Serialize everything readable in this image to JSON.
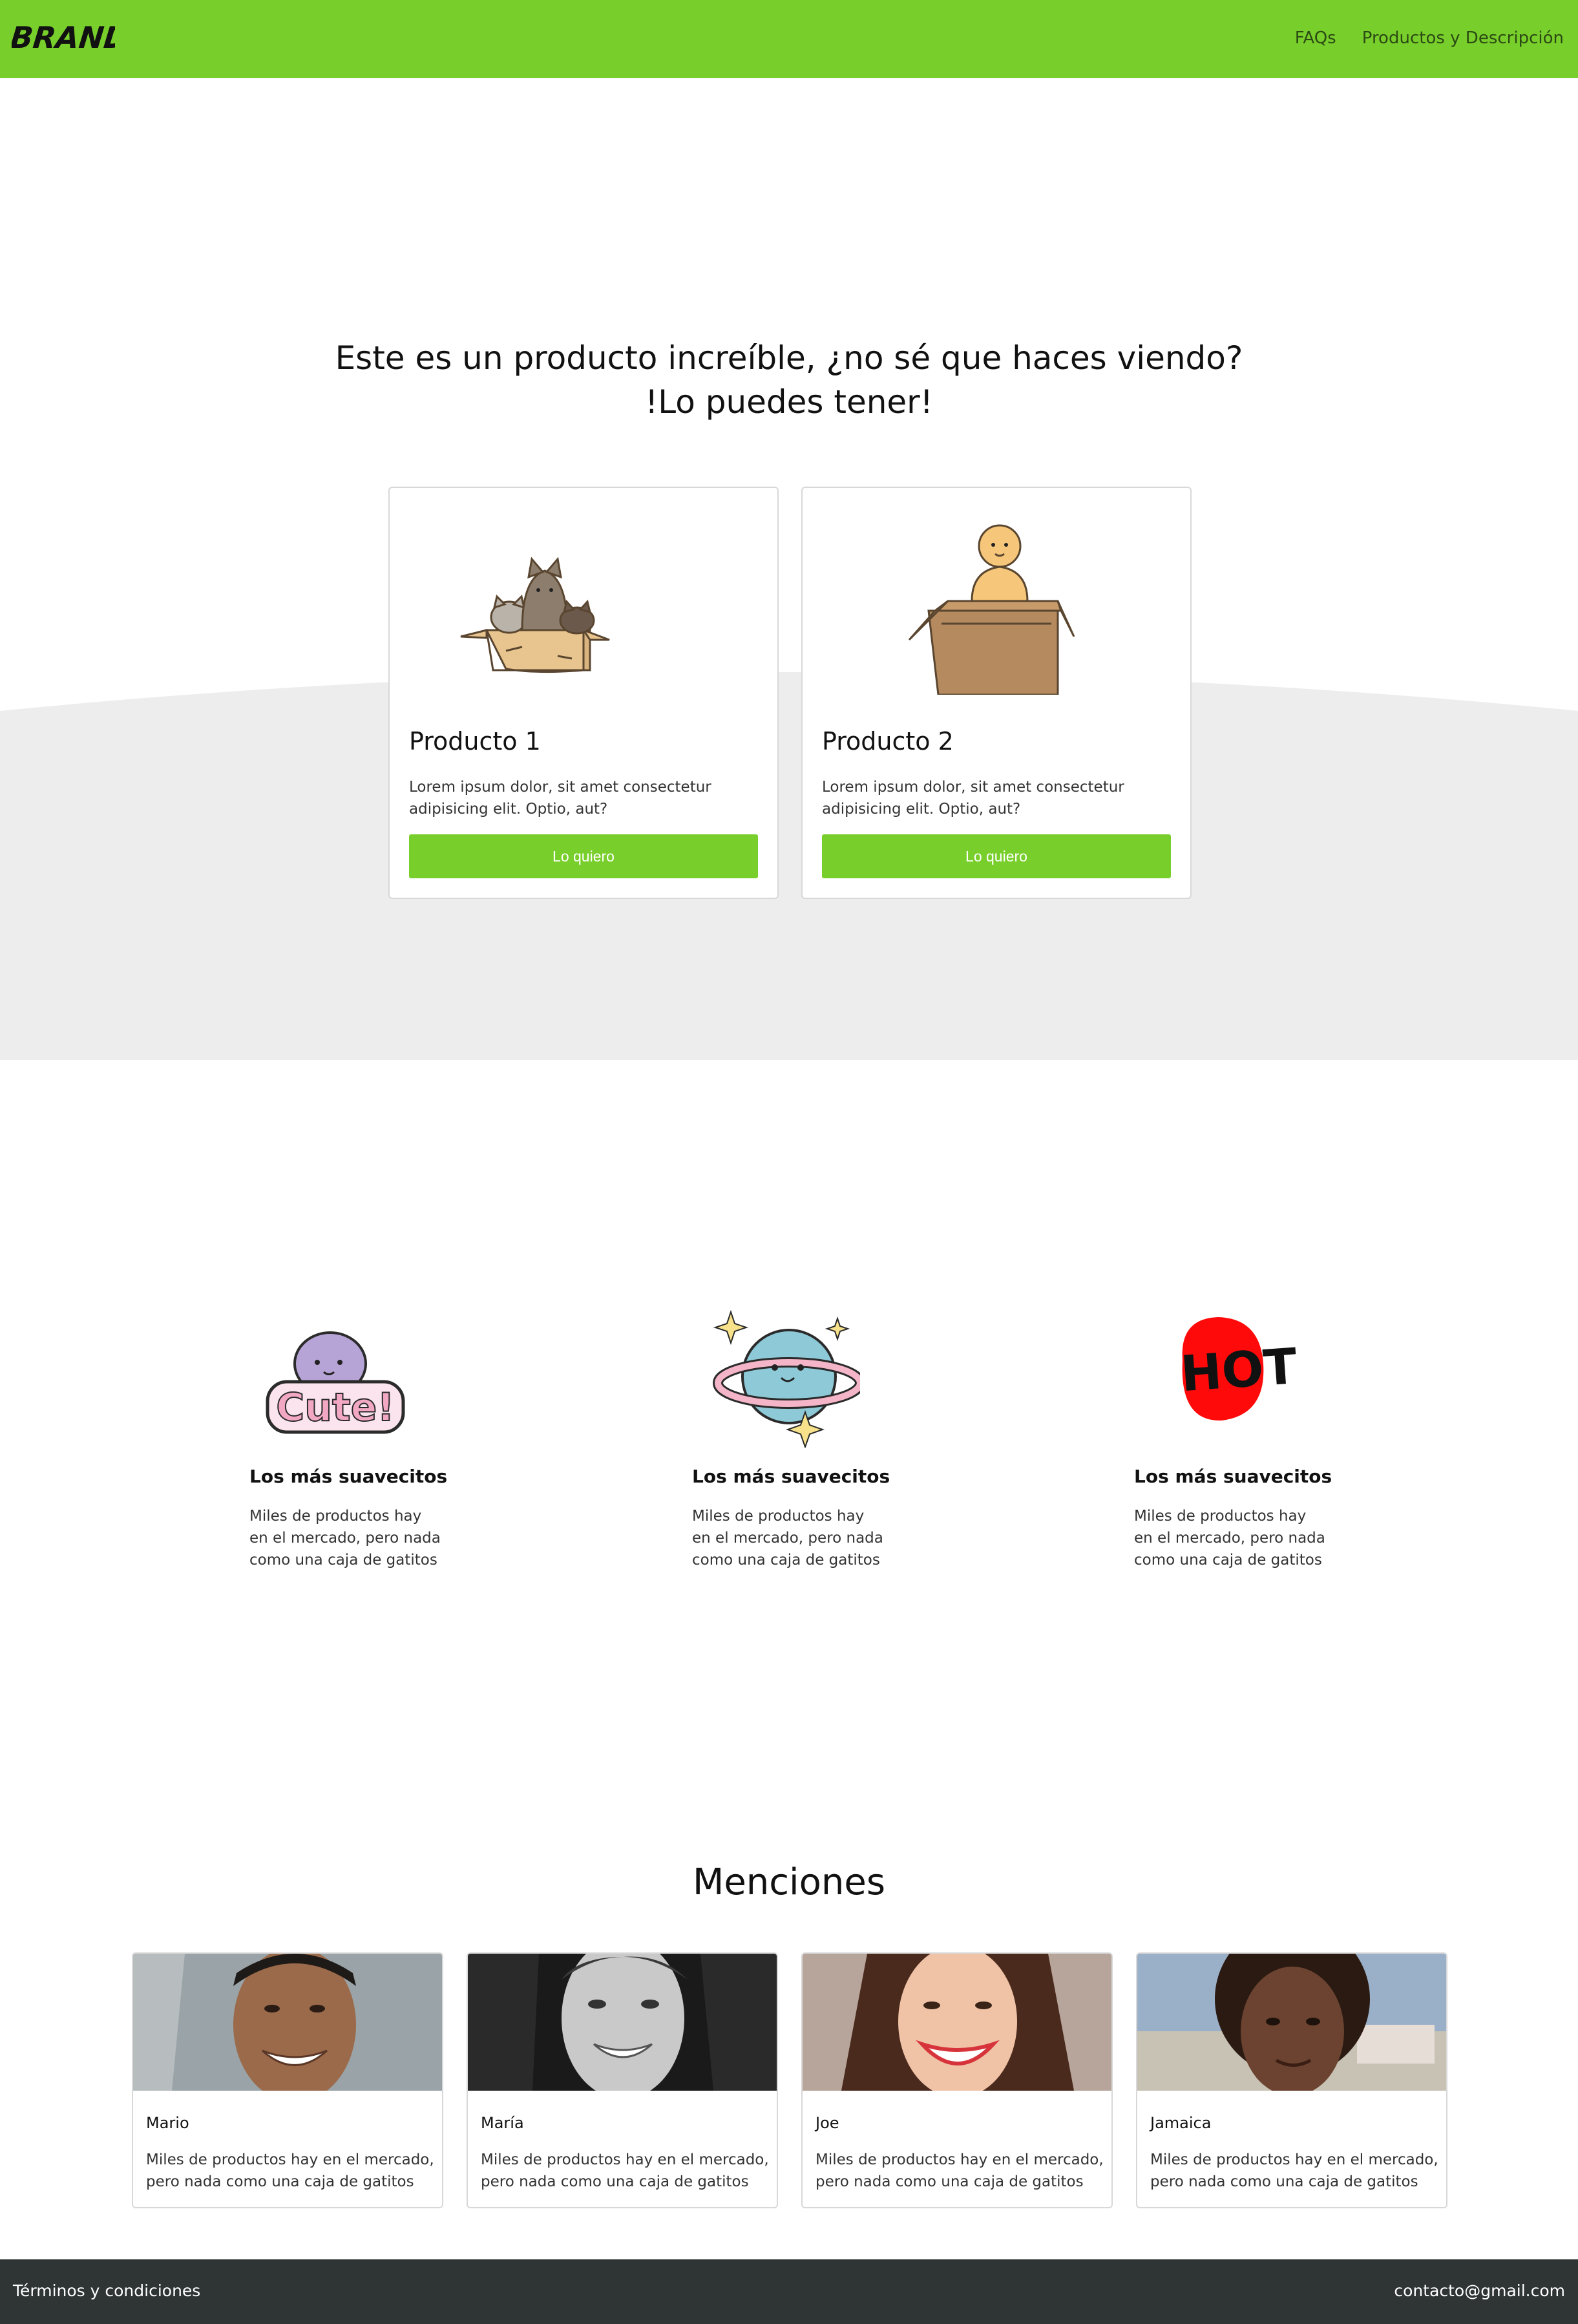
{
  "navbar": {
    "brand": "BRAND",
    "links": [
      "FAQs",
      "Productos y Descripción"
    ],
    "color": "#78cf2b"
  },
  "hero": {
    "title_line1": "Este es un producto increíble, ¿no sé que haces viendo?",
    "title_line2": "!Lo puedes tener!",
    "products": [
      {
        "title": "Producto 1",
        "description": "Lorem ipsum dolor, sit amet consectetur adipisicing elit. Optio, aut?",
        "button": "Lo quiero",
        "icon": "cats-in-box-icon"
      },
      {
        "title": "Producto 2",
        "description": "Lorem ipsum dolor, sit amet consectetur adipisicing elit. Optio, aut?",
        "button": "Lo quiero",
        "icon": "baby-in-box-icon"
      }
    ]
  },
  "features": [
    {
      "title": "Los más suavecitos",
      "description": "Miles de productos hay en el mercado, pero nada como una caja de gatitos",
      "icon": "cute-sticker-icon"
    },
    {
      "title": "Los más suavecitos",
      "description": "Miles de productos hay en el mercado, pero nada como una caja de gatitos",
      "icon": "planet-sticker-icon"
    },
    {
      "title": "Los más suavecitos",
      "description": "Miles de productos hay en el mercado, pero nada como una caja de gatitos",
      "icon": "hot-sticker-icon"
    }
  ],
  "mentions": {
    "title": "Menciones",
    "people": [
      {
        "name": "Mario",
        "text": "Miles de productos hay en el mercado, pero nada como una caja de gatitos"
      },
      {
        "name": "María",
        "text": "Miles de productos hay en el mercado, pero nada como una caja de gatitos"
      },
      {
        "name": "Joe",
        "text": "Miles de productos hay en el mercado, pero nada como una caja de gatitos"
      },
      {
        "name": "Jamaica",
        "text": "Miles de productos hay en el mercado, pero nada como una caja de gatitos"
      }
    ]
  },
  "footer": {
    "left": "Términos y condiciones",
    "right": "contacto@gmail.com",
    "color": "#2f3435"
  }
}
